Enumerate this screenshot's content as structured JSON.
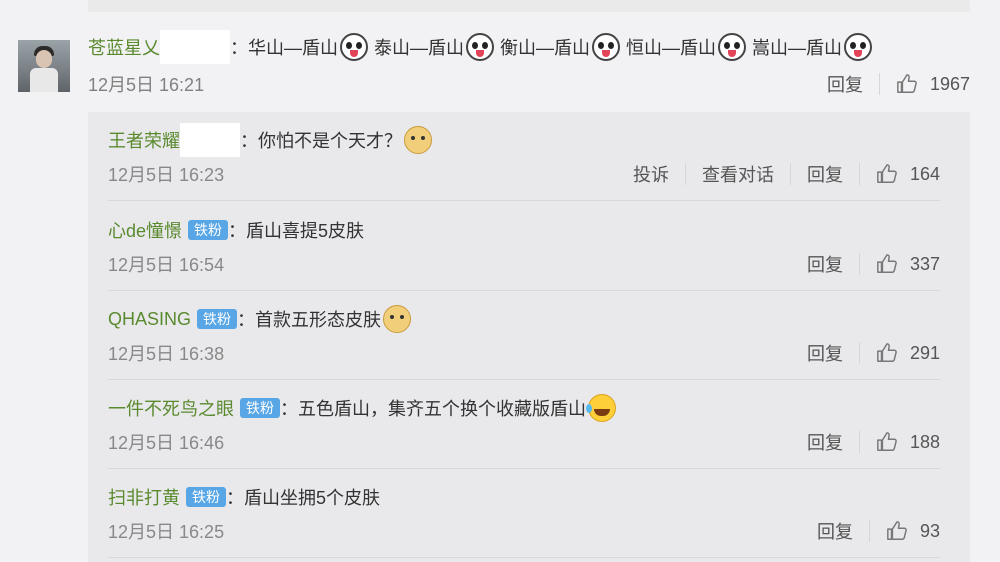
{
  "main_comment": {
    "username": "苍蓝星乂",
    "text_parts": [
      "：华山—盾山",
      "泰山—盾山",
      "衡山—盾山",
      "恒山—盾山",
      "嵩山—盾山"
    ],
    "time": "12月5日 16:21",
    "reply_label": "回复",
    "likes": "1967"
  },
  "replies": [
    {
      "username": "王者荣耀",
      "text": "：你怕不是个天才？",
      "time": "12月5日 16:23",
      "report_label": "投诉",
      "view_conversation_label": "查看对话",
      "reply_label": "回复",
      "likes": "164"
    },
    {
      "username": "心de憧憬",
      "badge": "铁粉",
      "text": "：盾山喜提5皮肤",
      "time": "12月5日 16:54",
      "reply_label": "回复",
      "likes": "337"
    },
    {
      "username": "QHASING",
      "badge": "铁粉",
      "text": "：首款五形态皮肤",
      "time": "12月5日 16:38",
      "reply_label": "回复",
      "likes": "291"
    },
    {
      "username": "一件不死鸟之眼",
      "badge": "铁粉",
      "text": "：五色盾山，集齐五个换个收藏版盾山",
      "time": "12月5日 16:46",
      "reply_label": "回复",
      "likes": "188"
    },
    {
      "username": "扫非打黄",
      "badge": "铁粉",
      "text": "：盾山坐拥5个皮肤",
      "time": "12月5日 16:25",
      "reply_label": "回复",
      "likes": "93"
    }
  ],
  "colors": {
    "username": "#5a8a2e",
    "badge": "#58a6e6",
    "background": "#f2f2f5",
    "reply_panel": "#e9e9ec"
  }
}
